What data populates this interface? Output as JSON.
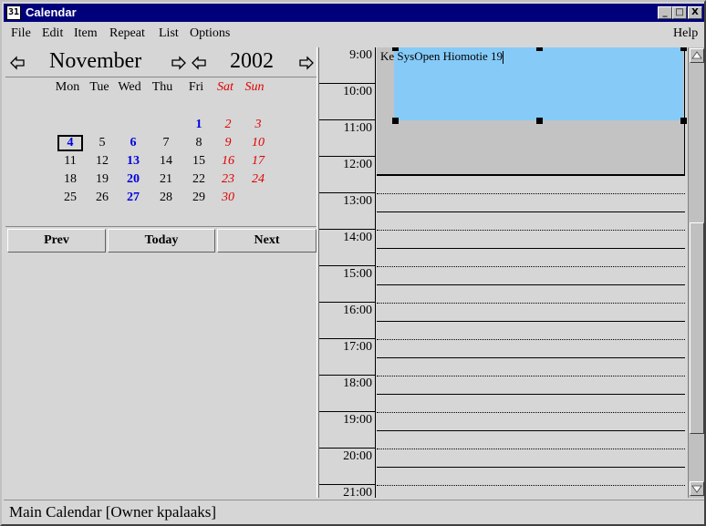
{
  "window": {
    "title": "Calendar",
    "icon": "calendar-app-icon",
    "controls": [
      "_",
      "□",
      "X"
    ]
  },
  "menu": {
    "items": [
      "File",
      "Edit",
      "Item",
      "Repeat",
      "List",
      "Options"
    ],
    "help": "Help"
  },
  "nav": {
    "month": "November",
    "year": "2002"
  },
  "calendar": {
    "weekdays": [
      "Mon",
      "Tue",
      "Wed",
      "Thu",
      "Fri",
      "Sat",
      "Sun"
    ],
    "weeks": [
      [
        "",
        "",
        "",
        "",
        "1",
        "2",
        "3"
      ],
      [
        "4",
        "5",
        "6",
        "7",
        "8",
        "9",
        "10"
      ],
      [
        "11",
        "12",
        "13",
        "14",
        "15",
        "16",
        "17"
      ],
      [
        "18",
        "19",
        "20",
        "21",
        "22",
        "23",
        "24"
      ],
      [
        "25",
        "26",
        "27",
        "28",
        "29",
        "30",
        ""
      ]
    ],
    "highlighted_days": [
      "1",
      "4",
      "6",
      "13",
      "20",
      "27"
    ],
    "selected_day": "4"
  },
  "buttons": {
    "prev": "Prev",
    "today": "Today",
    "next": "Next"
  },
  "dayview": {
    "hours": [
      "9:00",
      "10:00",
      "11:00",
      "12:00",
      "13:00",
      "14:00",
      "15:00",
      "16:00",
      "17:00",
      "18:00",
      "19:00",
      "20:00",
      "21:00"
    ],
    "appointment": {
      "text": "Ke SysOpen Hiomotie 19"
    }
  },
  "status": {
    "text": "Main Calendar [Owner kpalaaks]"
  },
  "colors": {
    "title_bar": "#00007b",
    "weekend": "#e00000",
    "event_day": "#0000e0",
    "appointment": "#86cbf8",
    "busy": "#c3c3c3"
  }
}
